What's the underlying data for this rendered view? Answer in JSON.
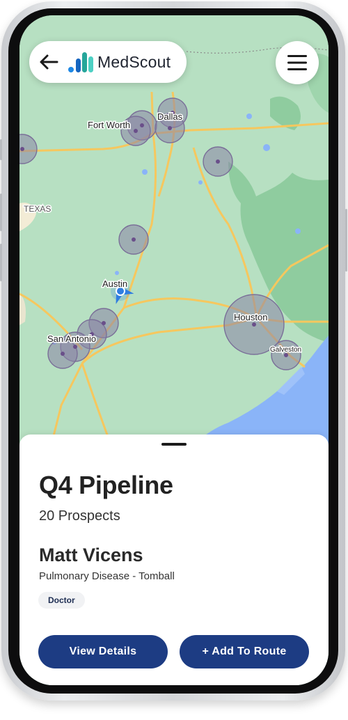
{
  "header": {
    "brand": "MedScout",
    "back_icon": "arrow-left-icon",
    "menu_icon": "hamburger-menu-icon"
  },
  "map": {
    "labels": {
      "fort_worth": "Fort Worth",
      "dallas": "Dallas",
      "texas": "TEXAS",
      "austin": "Austin",
      "san_antonio": "San Antonio",
      "houston": "Houston",
      "galveston": "Galveston"
    },
    "colors": {
      "land": "#b7e0c2",
      "forest": "#8fcc9f",
      "water": "#8ab4f8",
      "highway": "#f6c75e",
      "cluster_fill": "#8a83a6",
      "current_location": "#2f7de1"
    }
  },
  "panel": {
    "title": "Q4 Pipeline",
    "subtitle": "20 Prospects",
    "prospect": {
      "name": "Matt Vicens",
      "specialty": "Pulmonary Disease - Tomball",
      "badge": "Doctor"
    },
    "actions": {
      "view_details": "View Details",
      "add_to_route": "+ Add To Route"
    },
    "colors": {
      "button": "#1d3c83",
      "badge_bg": "#f1f2f4"
    }
  }
}
